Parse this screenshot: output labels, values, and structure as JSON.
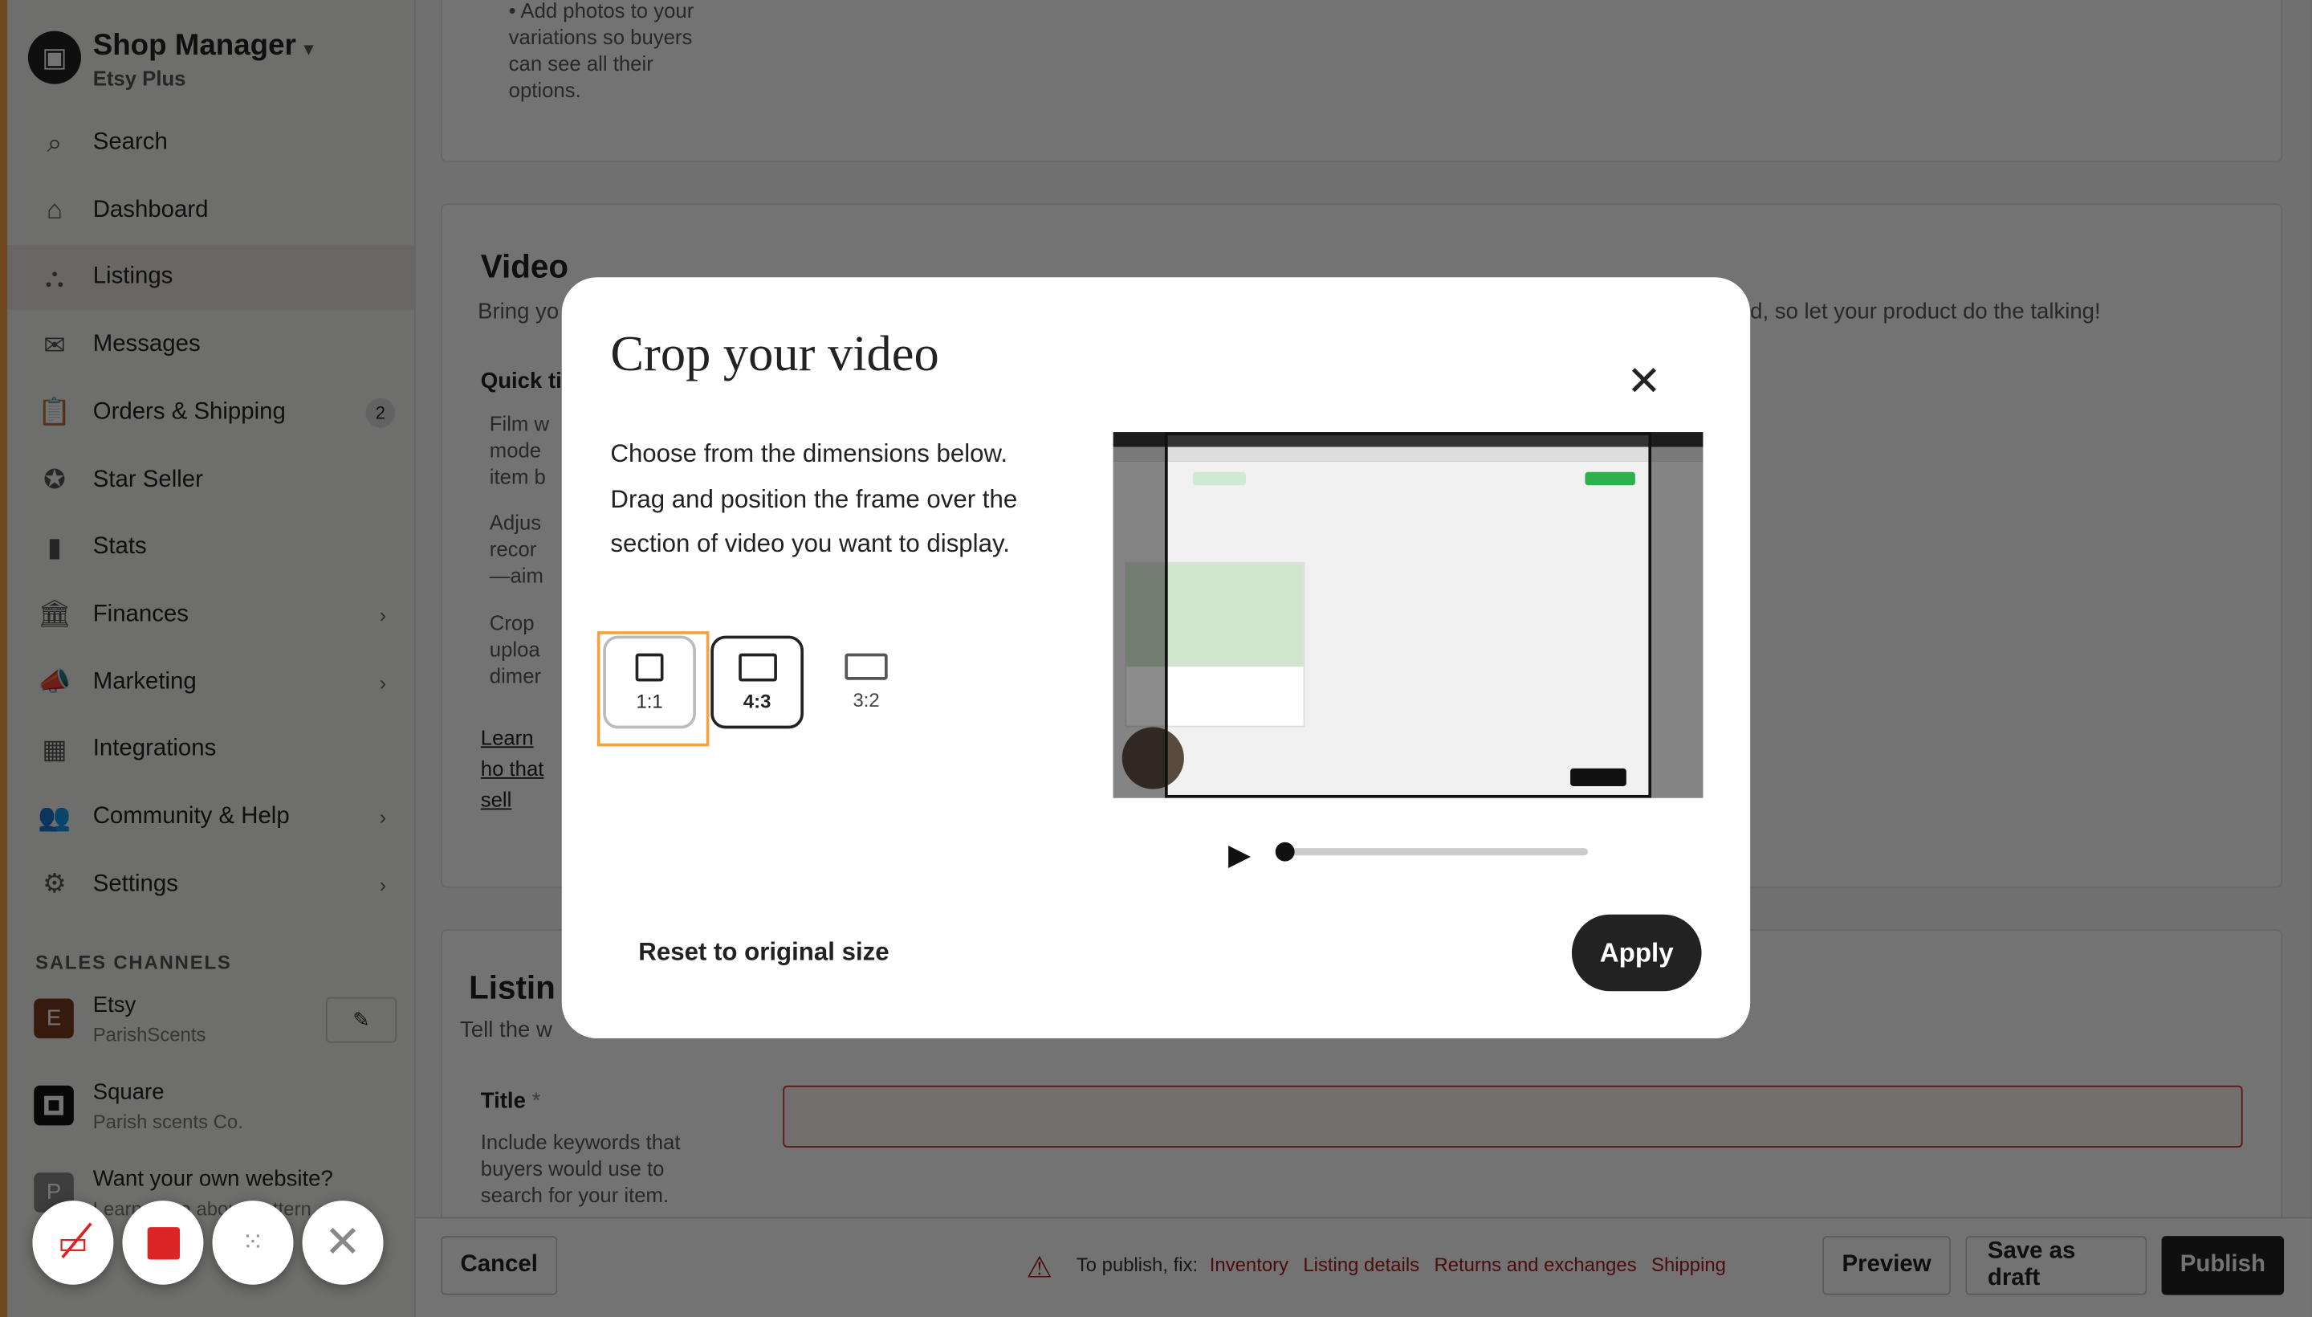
{
  "sidebar": {
    "shop_title": "Shop Manager",
    "shop_plan": "Etsy Plus",
    "items": [
      {
        "label": "Search",
        "icon": "search-icon"
      },
      {
        "label": "Dashboard",
        "icon": "home-icon"
      },
      {
        "label": "Listings",
        "icon": "listings-icon",
        "active": true
      },
      {
        "label": "Messages",
        "icon": "mail-icon"
      },
      {
        "label": "Orders & Shipping",
        "icon": "clipboard-icon",
        "badge": "2"
      },
      {
        "label": "Star Seller",
        "icon": "star-seller-icon"
      },
      {
        "label": "Stats",
        "icon": "bar-chart-icon"
      },
      {
        "label": "Finances",
        "icon": "bank-icon",
        "chevron": true
      },
      {
        "label": "Marketing",
        "icon": "megaphone-icon",
        "chevron": true
      },
      {
        "label": "Integrations",
        "icon": "grid-icon"
      },
      {
        "label": "Community & Help",
        "icon": "people-icon",
        "chevron": true
      },
      {
        "label": "Settings",
        "icon": "gear-icon",
        "chevron": true
      }
    ],
    "sales_channels_heading": "SALES CHANNELS",
    "channels": [
      {
        "initial": "E",
        "name": "Etsy",
        "sub": "ParishScents",
        "color": "#7a3a1e"
      },
      {
        "initial": "",
        "name": "Square",
        "sub": "Parish scents Co.",
        "color": "#111111"
      },
      {
        "initial": "P",
        "name": "Want your own website?",
        "sub": "Learn more about Pattern",
        "color": "#666666"
      }
    ]
  },
  "main": {
    "photos_tip": "Add photos to your variations so buyers can see all their options.",
    "video_heading": "Video",
    "video_intro_start": "Bring yo",
    "video_intro_end": "d, so let your product do the talking!",
    "quick_tips": "Quick ti",
    "tips": [
      "Film w mode item b",
      "Adjus recor —aim",
      "Crop uploa dimer"
    ],
    "learn_link": "Learn ho that sell",
    "listing_heading": "Listin",
    "listing_sub": "Tell the w",
    "title_label": "Title",
    "title_required": "*",
    "title_help": "Include keywords that buyers would use to search for your item."
  },
  "bottom_bar": {
    "cancel": "Cancel",
    "fix_prefix": "To publish, fix:",
    "fix_links": [
      "Inventory",
      "Listing details",
      "Returns and exchanges",
      "Shipping"
    ],
    "preview": "Preview",
    "save_draft": "Save as draft",
    "publish": "Publish"
  },
  "modal": {
    "title": "Crop your video",
    "description": "Choose from the dimensions below. Drag and position the frame over the section of video you want to display.",
    "ratios": [
      {
        "label": "1:1",
        "selected": true
      },
      {
        "label": "4:3"
      },
      {
        "label": "3:2"
      }
    ],
    "progress": 0,
    "reset": "Reset to original size",
    "apply": "Apply"
  },
  "recorder": {
    "buttons": [
      "camera-off-icon",
      "stop-icon",
      "dots-icon",
      "close-icon"
    ]
  },
  "colors": {
    "accent": "#f5a23d",
    "error": "#a61a1a",
    "focus": "#f5a23d"
  }
}
